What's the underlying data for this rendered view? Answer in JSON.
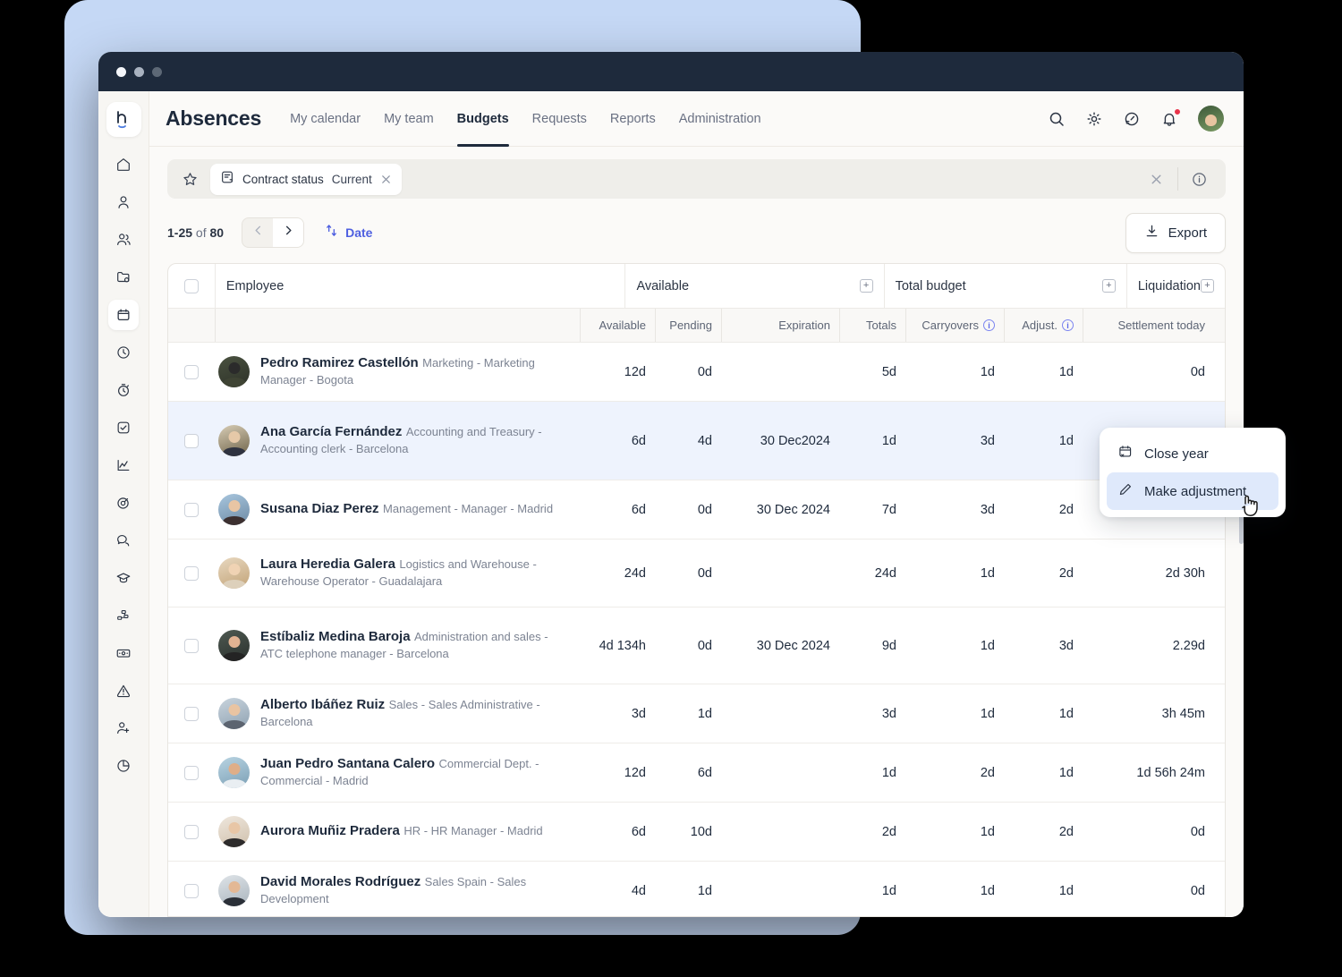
{
  "window": {
    "dots": [
      "close",
      "minimize",
      "maximize"
    ]
  },
  "header": {
    "brand": "Absences",
    "tabs": [
      {
        "label": "My calendar",
        "active": false
      },
      {
        "label": "My team",
        "active": false
      },
      {
        "label": "Budgets",
        "active": true
      },
      {
        "label": "Requests",
        "active": false
      },
      {
        "label": "Reports",
        "active": false
      },
      {
        "label": "Administration",
        "active": false
      }
    ],
    "icons": [
      {
        "name": "search-icon"
      },
      {
        "name": "gear-icon"
      },
      {
        "name": "speedometer-icon"
      },
      {
        "name": "bell-icon",
        "has_badge": true
      },
      {
        "name": "user-avatar"
      }
    ]
  },
  "sidebar": {
    "logo": "h",
    "items": [
      {
        "name": "home-icon"
      },
      {
        "name": "person-icon"
      },
      {
        "name": "people-icon"
      },
      {
        "name": "folder-icon"
      },
      {
        "name": "calendar-icon",
        "active": true
      },
      {
        "name": "clock-icon"
      },
      {
        "name": "stopwatch-icon"
      },
      {
        "name": "checkbox-icon"
      },
      {
        "name": "chart-line-icon"
      },
      {
        "name": "target-icon"
      },
      {
        "name": "chat-icon"
      },
      {
        "name": "graduation-cap-icon"
      },
      {
        "name": "workflow-icon"
      },
      {
        "name": "money-icon"
      },
      {
        "name": "alert-icon"
      },
      {
        "name": "add-user-icon"
      },
      {
        "name": "pie-chart-icon"
      }
    ]
  },
  "filterbar": {
    "star_icon": "star-icon",
    "chip": {
      "icon": "document-icon",
      "label": "Contract status",
      "value": "Current",
      "remove_icon": "close-icon"
    },
    "clear_icon": "close-icon",
    "info_icon": "info-icon"
  },
  "pagination": {
    "range": "1-25",
    "of": "of",
    "total": "80",
    "prev_icon": "chevron-left-icon",
    "next_icon": "chevron-right-icon",
    "sort_label": "Date",
    "sort_icon": "sort-icon",
    "export_label": "Export",
    "export_icon": "download-icon"
  },
  "table": {
    "group_headers": [
      {
        "label": "Employee",
        "expandable": false
      },
      {
        "label": "Available",
        "expandable": true
      },
      {
        "label": "Total budget",
        "expandable": true
      },
      {
        "label": "Liquidation",
        "expandable": true
      }
    ],
    "sub_headers": {
      "available": "Available",
      "pending": "Pending",
      "expiration": "Expiration",
      "totals": "Totals",
      "carryovers": "Carryovers",
      "adjust": "Adjust.",
      "settlement": "Settlement today"
    },
    "rows": [
      {
        "name": "Pedro Ramirez Castellón",
        "role": "Marketing - Marketing Manager - Bogota",
        "available": "12d",
        "pending": "0d",
        "expiration": "",
        "totals": "5d",
        "carryovers": "1d",
        "adjust": "1d",
        "settlement": "0d",
        "highlighted": false
      },
      {
        "name": "Ana García Fernández",
        "role": "Accounting and Treasury - Accounting clerk - Barcelona",
        "available": "6d",
        "pending": "4d",
        "expiration": "30 Dec2024",
        "totals": "1d",
        "carryovers": "3d",
        "adjust": "1d",
        "settlement": "",
        "highlighted": true
      },
      {
        "name": "Susana Diaz Perez",
        "role": "Management - Manager - Madrid",
        "available": "6d",
        "pending": "0d",
        "expiration": "30 Dec 2024",
        "totals": "7d",
        "carryovers": "3d",
        "adjust": "2d",
        "settlement": "",
        "highlighted": false
      },
      {
        "name": "Laura Heredia Galera",
        "role": "Logistics and Warehouse - Warehouse Operator - Guadalajara",
        "available": "24d",
        "pending": "0d",
        "expiration": "",
        "totals": "24d",
        "carryovers": "1d",
        "adjust": "2d",
        "settlement": "2d 30h",
        "highlighted": false
      },
      {
        "name": "Estíbaliz Medina Baroja",
        "role": "Administration and sales - ATC telephone manager - Barcelona",
        "available": "4d 134h",
        "pending": "0d",
        "expiration": "30 Dec 2024",
        "totals": "9d",
        "carryovers": "1d",
        "adjust": "3d",
        "settlement": "2.29d",
        "highlighted": false
      },
      {
        "name": "Alberto Ibáñez Ruiz",
        "role": "Sales - Sales Administrative - Barcelona",
        "available": "3d",
        "pending": "1d",
        "expiration": "",
        "totals": "3d",
        "carryovers": "1d",
        "adjust": "1d",
        "settlement": "3h 45m",
        "highlighted": false
      },
      {
        "name": "Juan Pedro Santana Calero",
        "role": "Commercial Dept. - Commercial - Madrid",
        "available": "12d",
        "pending": "6d",
        "expiration": "",
        "totals": "1d",
        "carryovers": "2d",
        "adjust": "1d",
        "settlement": "1d 56h 24m",
        "highlighted": false
      },
      {
        "name": "Aurora Muñiz Pradera",
        "role": "HR - HR Manager - Madrid",
        "available": "6d",
        "pending": "10d",
        "expiration": "",
        "totals": "2d",
        "carryovers": "1d",
        "adjust": "2d",
        "settlement": "0d",
        "highlighted": false
      },
      {
        "name": "David Morales Rodríguez",
        "role": "Sales Spain - Sales Development",
        "available": "4d",
        "pending": "1d",
        "expiration": "",
        "totals": "1d",
        "carryovers": "1d",
        "adjust": "1d",
        "settlement": "0d",
        "highlighted": false
      }
    ]
  },
  "context_menu": {
    "items": [
      {
        "label": "Close year",
        "icon": "calendar-close-icon",
        "selected": false
      },
      {
        "label": "Make adjustment",
        "icon": "pencil-icon",
        "selected": true
      }
    ]
  },
  "colors": {
    "titlebar": "#1e2a3c",
    "accent": "#4e5fe0",
    "row_highlight": "#eef3fd",
    "menu_selected": "#dfe9fb",
    "backdrop_blue": "#c5d8f5",
    "notification_dot": "#e8334a"
  }
}
